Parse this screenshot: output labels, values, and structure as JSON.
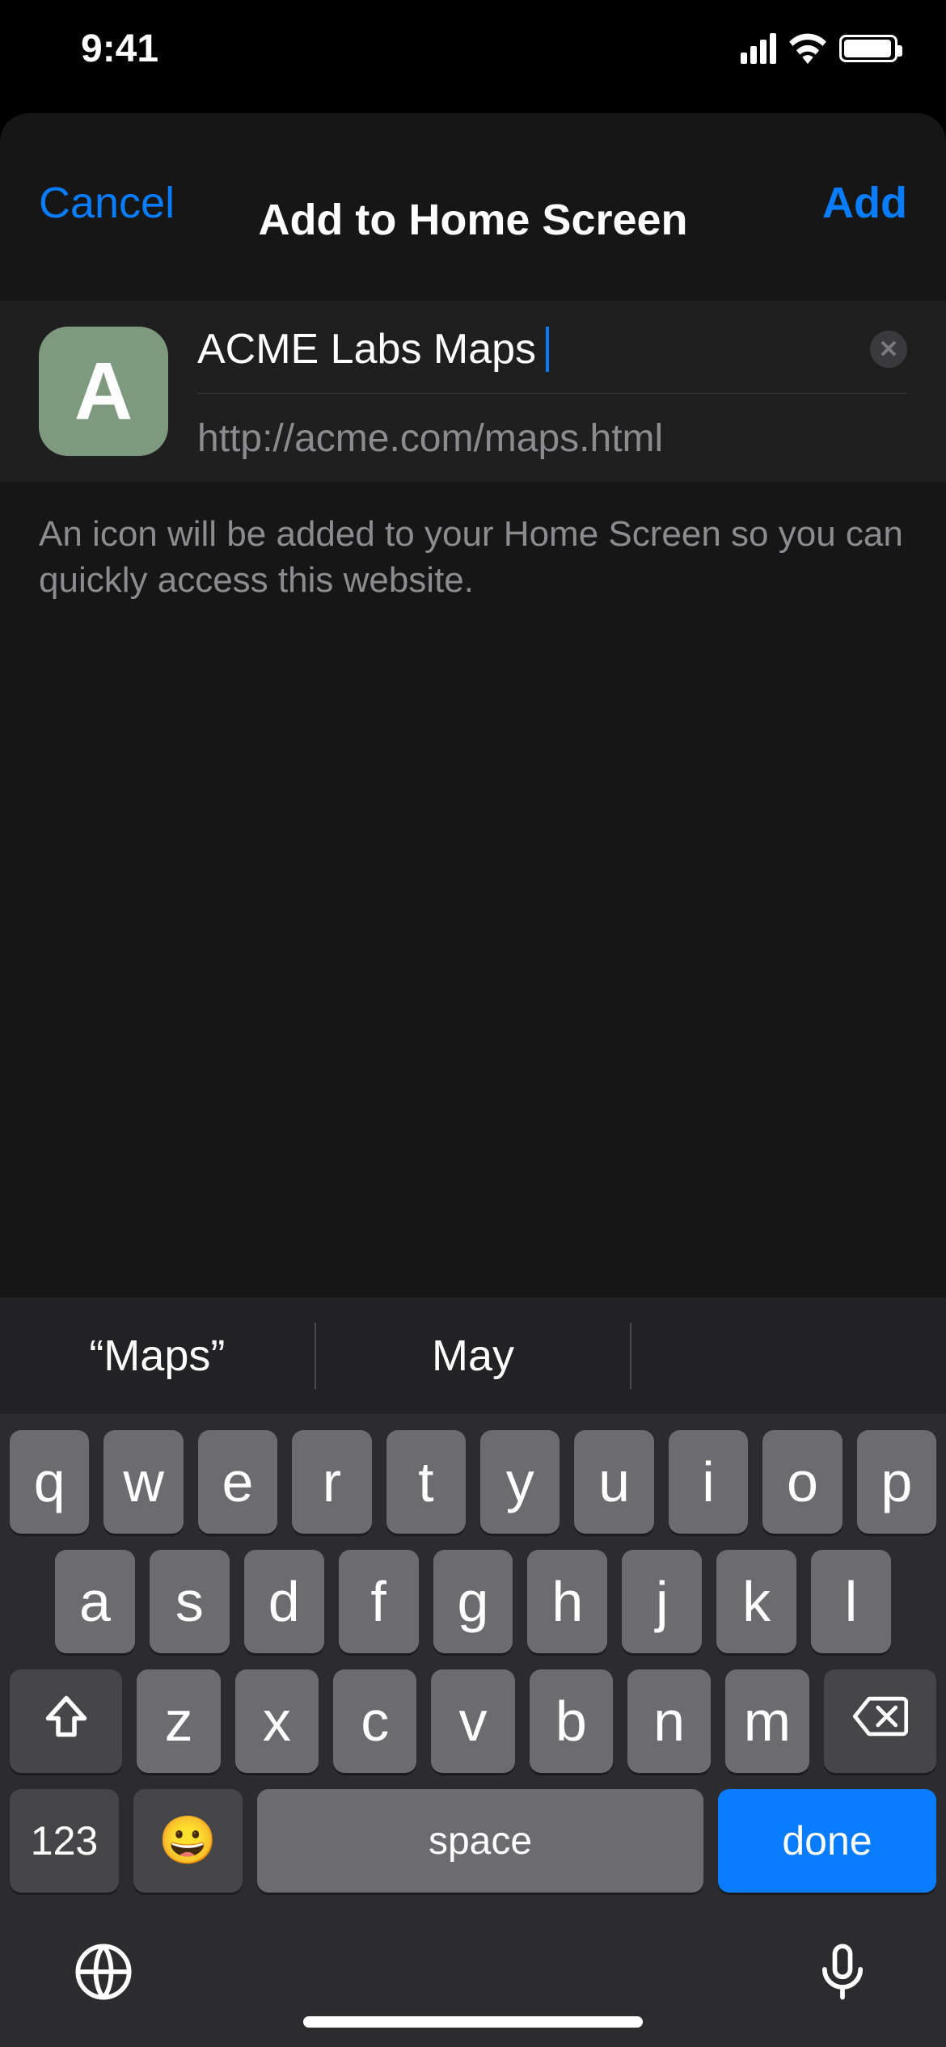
{
  "status": {
    "time": "9:41"
  },
  "sheet": {
    "cancel_label": "Cancel",
    "title": "Add to Home Screen",
    "add_label": "Add",
    "icon_letter": "A",
    "bookmark_title": "ACME Labs Maps",
    "bookmark_url": "http://acme.com/maps.html",
    "helper": "An icon will be added to your Home Screen so you can quickly access this website."
  },
  "keyboard": {
    "suggestions": [
      "“Maps”",
      "May",
      ""
    ],
    "row1": [
      "q",
      "w",
      "e",
      "r",
      "t",
      "y",
      "u",
      "i",
      "o",
      "p"
    ],
    "row2": [
      "a",
      "s",
      "d",
      "f",
      "g",
      "h",
      "j",
      "k",
      "l"
    ],
    "row3": [
      "z",
      "x",
      "c",
      "v",
      "b",
      "n",
      "m"
    ],
    "numbers_label": "123",
    "space_label": "space",
    "done_label": "done"
  }
}
